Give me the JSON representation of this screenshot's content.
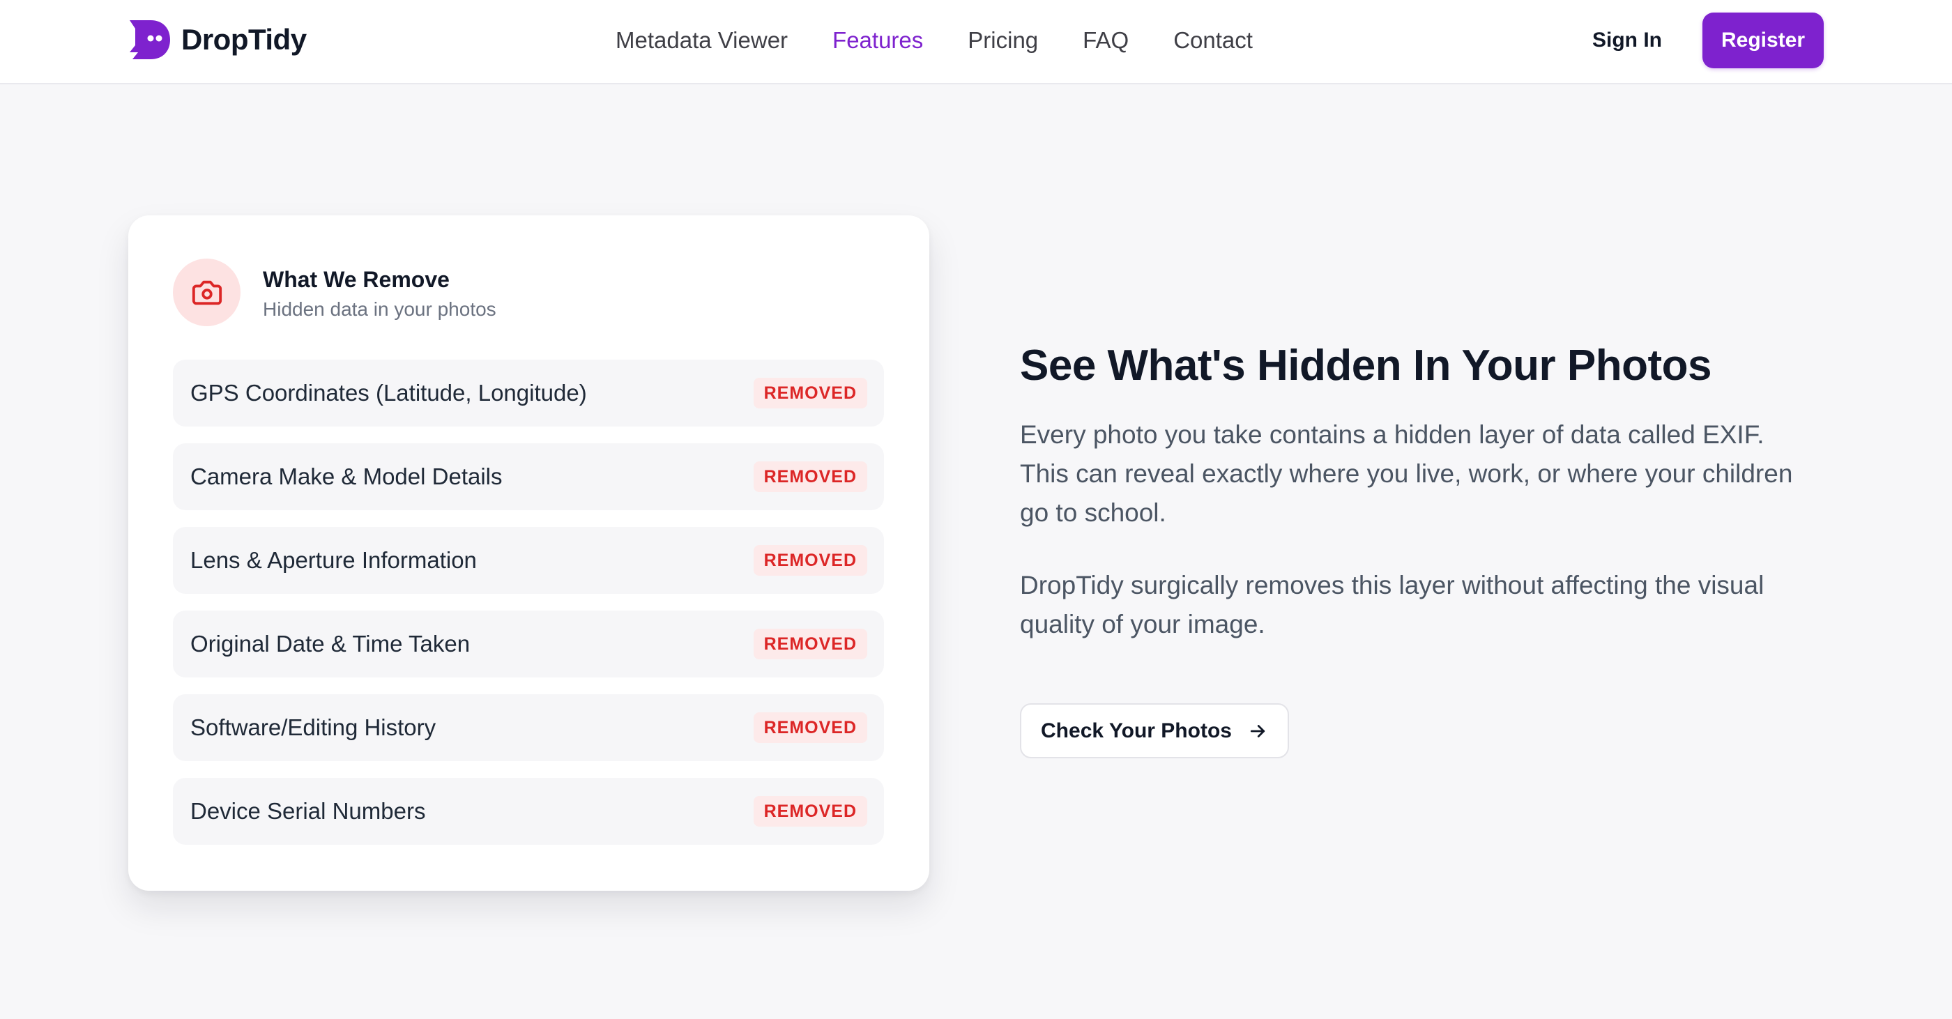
{
  "brand": {
    "name": "DropTidy",
    "logo_icon": "droptidy-ghost-logo",
    "accent_color": "#7e22ce"
  },
  "nav": {
    "items": [
      {
        "label": "Metadata Viewer",
        "active": false
      },
      {
        "label": "Features",
        "active": true
      },
      {
        "label": "Pricing",
        "active": false
      },
      {
        "label": "FAQ",
        "active": false
      },
      {
        "label": "Contact",
        "active": false
      }
    ],
    "sign_in": "Sign In",
    "register": "Register"
  },
  "card": {
    "icon": "camera-icon",
    "title": "What We Remove",
    "subtitle": "Hidden data in your photos",
    "badge_color": "#dc2626",
    "rows": [
      {
        "label": "GPS Coordinates (Latitude, Longitude)",
        "status": "REMOVED"
      },
      {
        "label": "Camera Make & Model Details",
        "status": "REMOVED"
      },
      {
        "label": "Lens & Aperture Information",
        "status": "REMOVED"
      },
      {
        "label": "Original Date & Time Taken",
        "status": "REMOVED"
      },
      {
        "label": "Software/Editing History",
        "status": "REMOVED"
      },
      {
        "label": "Device Serial Numbers",
        "status": "REMOVED"
      }
    ]
  },
  "hero": {
    "headline": "See What's Hidden In Your Photos",
    "paragraph_1": "Every photo you take contains a hidden layer of data called EXIF. This can reveal exactly where you live, work, or where your children go to school.",
    "paragraph_2": "DropTidy surgically removes this layer without affecting the visual quality of your image.",
    "cta_label": "Check Your Photos",
    "cta_icon": "arrow-right-icon"
  }
}
